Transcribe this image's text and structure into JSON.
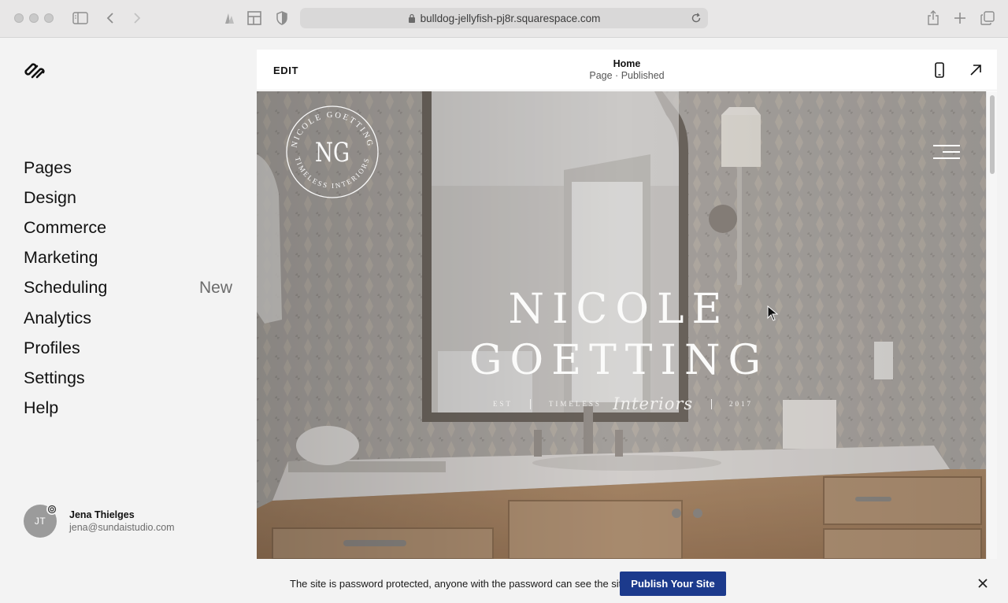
{
  "browser": {
    "url": "bulldog-jellyfish-pj8r.squarespace.com",
    "icons": [
      "sidebar-toggle-icon",
      "back-icon",
      "forward-icon",
      "extension-icon",
      "layout-icon",
      "shield-icon",
      "lock-icon",
      "reload-icon",
      "share-icon",
      "new-tab-icon",
      "tabs-overview-icon"
    ]
  },
  "sidebar": {
    "logo": "squarespace-logo-icon",
    "items": [
      {
        "label": "Pages",
        "badge": ""
      },
      {
        "label": "Design",
        "badge": ""
      },
      {
        "label": "Commerce",
        "badge": ""
      },
      {
        "label": "Marketing",
        "badge": ""
      },
      {
        "label": "Scheduling",
        "badge": "New"
      },
      {
        "label": "Analytics",
        "badge": ""
      },
      {
        "label": "Profiles",
        "badge": ""
      },
      {
        "label": "Settings",
        "badge": ""
      },
      {
        "label": "Help",
        "badge": ""
      }
    ],
    "user": {
      "initials": "JT",
      "name": "Jena Thielges",
      "email": "jena@sundaistudio.com"
    }
  },
  "preview": {
    "edit_label": "EDIT",
    "page_name": "Home",
    "page_status": "Page · Published",
    "icons": [
      "mobile-view-icon",
      "open-external-icon"
    ],
    "hero": {
      "title_line1": "NICOLE",
      "title_line2": "GOETTING",
      "tag_est": "EST",
      "tag_timeless": "TIMELESS",
      "tag_script": "Interiors",
      "tag_year": "2017",
      "logo_top_text": "NICOLE GOETTING",
      "logo_bottom_text": "TIMELESS INTERIORS",
      "logo_monogram": "NG"
    }
  },
  "notice": {
    "text": "The site is password protected, anyone with the password can see the site.",
    "publish_label": "Publish Your Site"
  },
  "colors": {
    "publish_button": "#1c3a8c",
    "sidebar_bg": "#f3f3f3",
    "chrome_bg": "#e8e7e7"
  }
}
